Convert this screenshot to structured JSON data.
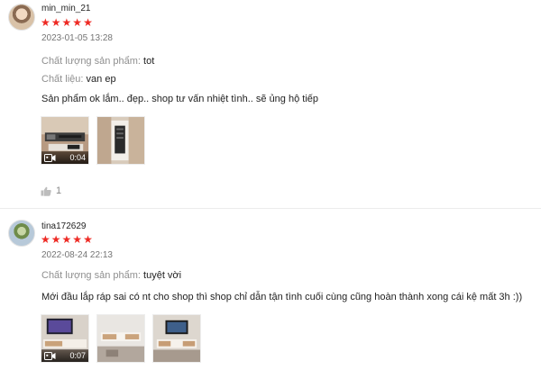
{
  "reviews": [
    {
      "username": "min_min_21",
      "rating": 5,
      "date": "2023-01-05 13:28",
      "attributes": [
        {
          "label": "Chất lượng sản phẩm:",
          "value": "tot"
        },
        {
          "label": "Chất liệu:",
          "value": "van ep"
        }
      ],
      "text": "Sản phẩm ok lắm.. đẹp.. shop tư vấn nhiệt tình.. sẽ ủng hộ tiếp",
      "media": [
        {
          "type": "video",
          "duration": "0:04"
        },
        {
          "type": "image"
        }
      ],
      "likes": "1"
    },
    {
      "username": "tina172629",
      "rating": 5,
      "date": "2022-08-24 22:13",
      "attributes": [
        {
          "label": "Chất lượng sản phẩm:",
          "value": "tuyệt vời"
        }
      ],
      "text": "Mới đầu lắp ráp sai có nt cho shop thì shop chỉ dẫn tận tình cuối cùng cũng hoàn thành xong cái kệ mất 3h :))",
      "media": [
        {
          "type": "video",
          "duration": "0:07"
        },
        {
          "type": "image"
        },
        {
          "type": "image"
        }
      ]
    }
  ],
  "colors": {
    "star": "#ee2a24",
    "muted_label": "#8f8f8f",
    "date": "#757575"
  },
  "icons": {
    "star": "star-icon",
    "video": "video-camera-icon",
    "like": "thumbs-up-icon"
  }
}
